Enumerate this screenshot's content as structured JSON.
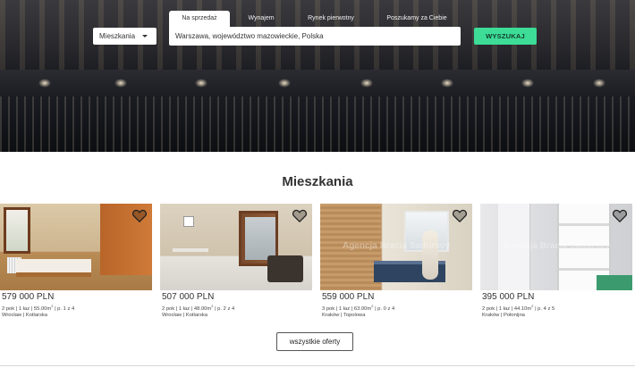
{
  "search": {
    "tabs": [
      {
        "label": "Na sprzedaż",
        "active": true
      },
      {
        "label": "Wynajem",
        "active": false
      },
      {
        "label": "Rynek pierwotny",
        "active": false
      },
      {
        "label": "Poszukamy za Ciebie",
        "active": false
      }
    ],
    "property_type": "Mieszkania",
    "location_value": "Warszawa, województwo mazowieckie, Polska",
    "button_label": "WYSZUKAJ"
  },
  "section": {
    "title": "Mieszkania",
    "cards": [
      {
        "price": "579 000 PLN",
        "details_pre": "2 pok | 1 łaz | 55.00m",
        "details_sup": "2",
        "details_post": " | p. 1 z 4",
        "location": "Wrocław | Kotlarska",
        "watermark": ""
      },
      {
        "price": "507 000 PLN",
        "details_pre": "2 pok | 1 łaz | 48.00m",
        "details_sup": "2",
        "details_post": " | p. 2 z 4",
        "location": "Wrocław | Kotlarska",
        "watermark": ""
      },
      {
        "price": "559 000 PLN",
        "details_pre": "3 pok | 1 łaz | 63.00m",
        "details_sup": "2",
        "details_post": " | p. 0 z 4",
        "location": "Kraków | Topolowa",
        "watermark": "Agencja Bracia Sadurscy"
      },
      {
        "price": "395 000 PLN",
        "details_pre": "2 pok | 1 łaz | 44.10m",
        "details_sup": "2",
        "details_post": " | p. 4 z 5",
        "location": "Kraków | Połonijna",
        "watermark": "Agencja Bracia Sadurscy"
      }
    ],
    "all_offers_label": "wszystkie oferty"
  },
  "colors": {
    "accent": "#3ddc97",
    "text": "#333333"
  },
  "icons": {
    "favorite": "heart-icon",
    "select_caret": "caret-down-icon"
  }
}
